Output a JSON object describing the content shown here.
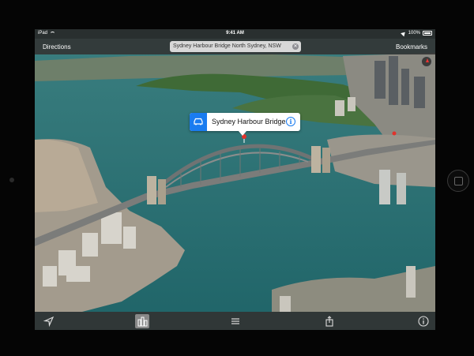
{
  "status_bar": {
    "device": "iPad",
    "time": "9:41 AM",
    "battery": "100%"
  },
  "nav_bar": {
    "directions_label": "Directions",
    "search_value": "Sydney Harbour Bridge North Sydney, NSW",
    "bookmarks_label": "Bookmarks"
  },
  "callout": {
    "title": "Sydney Harbour Bridge"
  },
  "colors": {
    "accent": "#1a7cf0",
    "water": "#2b6f73",
    "bar": "#333333"
  },
  "icons": [
    "location-arrow-icon",
    "3d-buildings-icon",
    "list-icon",
    "share-icon",
    "info-icon",
    "car-icon",
    "compass-icon",
    "wifi-icon",
    "battery-icon"
  ]
}
